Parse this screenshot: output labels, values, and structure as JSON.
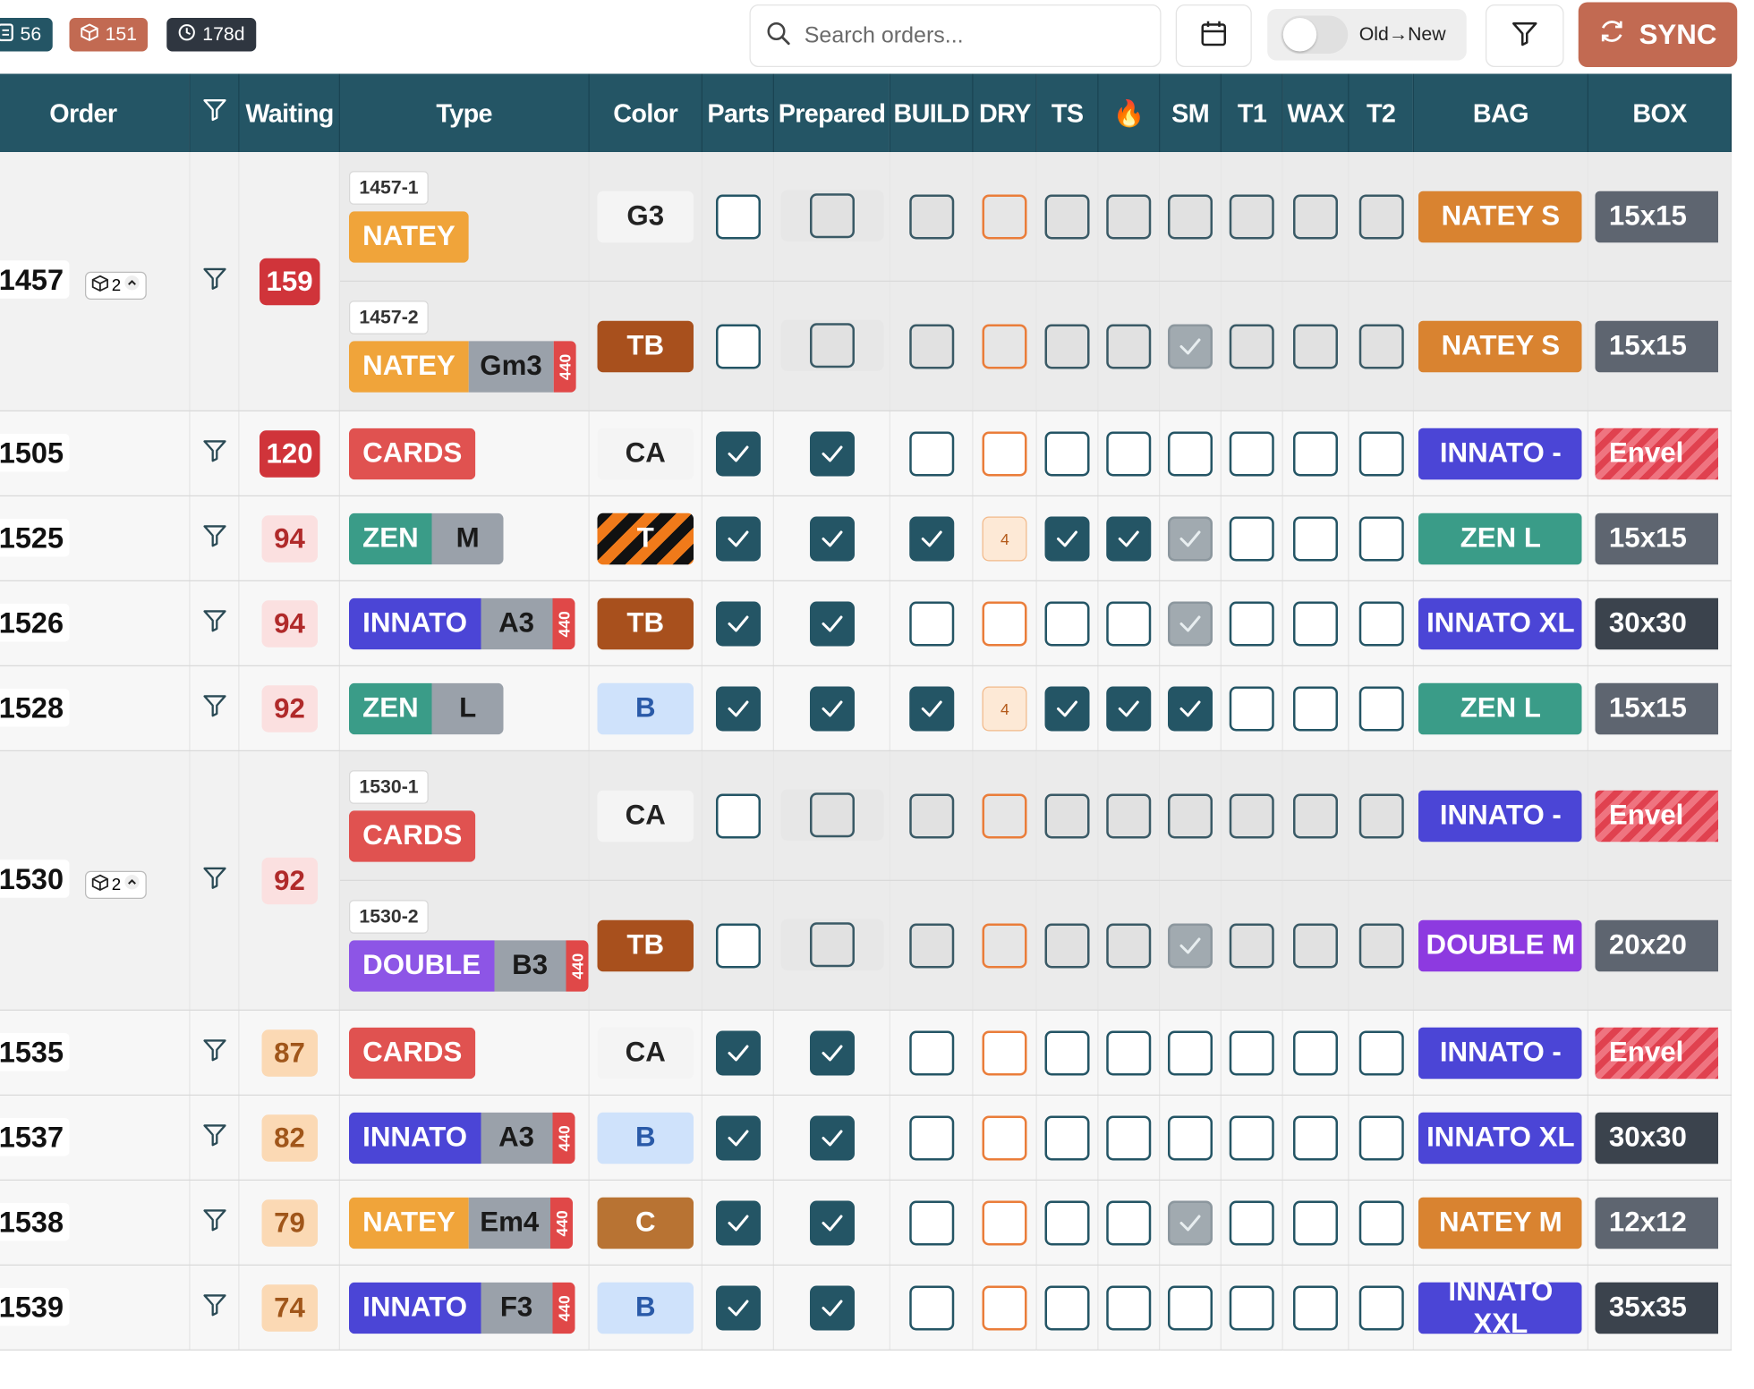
{
  "stats": {
    "orders": "56",
    "parts": "151",
    "age": "178d"
  },
  "search": {
    "placeholder": "Search orders..."
  },
  "sort_toggle": {
    "label": "Old→New"
  },
  "sync": {
    "label": "SYNC"
  },
  "columns": [
    "Order",
    "",
    "Waiting",
    "Type",
    "Color",
    "Parts",
    "Prepared",
    "BUILD",
    "DRY",
    "TS",
    "🔥",
    "SM",
    "T1",
    "WAX",
    "T2",
    "BAG",
    "BOX"
  ],
  "colors": {
    "header": "#245565",
    "natey": "#f0a43a",
    "cards": "#e05250",
    "zen": "#3a9c88",
    "innato": "#4b45d6",
    "double": "#8d55e6",
    "bag_natey": "#d98330",
    "bag_innato": "#4b45d6",
    "bag_zen": "#3a9c88",
    "bag_double": "#8d3ae0",
    "box_dark": "#5e6570",
    "box_darker": "#3b434d"
  },
  "orders": [
    {
      "num": "1457",
      "suborders": "2",
      "waiting": "159",
      "wait_bg": "#d0343a",
      "wait_fg": "#ffffff",
      "subs": [
        {
          "id": "1457-1",
          "type": "NATEY",
          "type_color": "#f0a43a",
          "variant": "",
          "tag": "",
          "color": "G3",
          "color_bg": "#f4f4f4",
          "color_fg": "#222222",
          "checks": [
            "empty",
            "dim",
            "dim",
            "odim",
            "dim",
            "dim",
            "dim",
            "dim",
            "dim",
            "dim"
          ],
          "bag": "NATEY S",
          "bag_bg": "#d98330",
          "box": "15x15",
          "box_type": "dark"
        },
        {
          "id": "1457-2",
          "type": "NATEY",
          "type_color": "#f0a43a",
          "variant": "Gm3",
          "tag": "440",
          "color": "TB",
          "color_bg": "#a8501d",
          "color_fg": "#ffffff",
          "checks": [
            "empty",
            "dim",
            "dim",
            "odim",
            "dim",
            "dim",
            "grey",
            "dim",
            "dim",
            "dim"
          ],
          "bag": "NATEY S",
          "bag_bg": "#d98330",
          "box": "15x15",
          "box_type": "dark"
        }
      ]
    },
    {
      "num": "1505",
      "waiting": "120",
      "wait_bg": "#d0343a",
      "wait_fg": "#ffffff",
      "type": "CARDS",
      "type_color": "#e05250",
      "variant": "",
      "tag": "",
      "color": "CA",
      "color_bg": "#f4f4f4",
      "color_fg": "#222222",
      "checks": [
        "checked",
        "checked",
        "empty",
        "orange",
        "empty",
        "empty",
        "empty",
        "empty",
        "empty",
        "empty"
      ],
      "bag": "INNATO -",
      "bag_bg": "#4b45d6",
      "box": "Envel",
      "box_type": "env"
    },
    {
      "num": "1525",
      "waiting": "94",
      "wait_bg": "#fbe0e0",
      "wait_fg": "#b02a2a",
      "type": "ZEN",
      "type_color": "#3a9c88",
      "variant": "M",
      "tag": "",
      "color": "T",
      "color_bg": "hazard",
      "color_fg": "#ffffff",
      "checks": [
        "checked",
        "checked",
        "checked",
        "num",
        "checked",
        "checked",
        "grey",
        "empty",
        "empty",
        "empty"
      ],
      "dry_num": "4",
      "bag": "ZEN L",
      "bag_bg": "#3a9c88",
      "box": "15x15",
      "box_type": "dark"
    },
    {
      "num": "1526",
      "waiting": "94",
      "wait_bg": "#fbe0e0",
      "wait_fg": "#b02a2a",
      "type": "INNATO",
      "type_color": "#4b45d6",
      "variant": "A3",
      "tag": "440",
      "color": "TB",
      "color_bg": "#a8501d",
      "color_fg": "#ffffff",
      "checks": [
        "checked",
        "checked",
        "empty",
        "orange",
        "empty",
        "empty",
        "grey",
        "empty",
        "empty",
        "empty"
      ],
      "bag": "INNATO XL",
      "bag_bg": "#4b45d6",
      "box": "30x30",
      "box_type": "darker"
    },
    {
      "num": "1528",
      "waiting": "92",
      "wait_bg": "#fbe0e0",
      "wait_fg": "#b02a2a",
      "type": "ZEN",
      "type_color": "#3a9c88",
      "variant": "L",
      "tag": "",
      "color": "B",
      "color_bg": "#cfe2fb",
      "color_fg": "#2a5aa8",
      "checks": [
        "checked",
        "checked",
        "checked",
        "num",
        "checked",
        "checked",
        "checked",
        "empty",
        "empty",
        "empty"
      ],
      "dry_num": "4",
      "bag": "ZEN L",
      "bag_bg": "#3a9c88",
      "box": "15x15",
      "box_type": "dark"
    },
    {
      "num": "1530",
      "suborders": "2",
      "waiting": "92",
      "wait_bg": "#fbe0e0",
      "wait_fg": "#b02a2a",
      "subs": [
        {
          "id": "1530-1",
          "type": "CARDS",
          "type_color": "#e05250",
          "variant": "",
          "tag": "",
          "color": "CA",
          "color_bg": "#f4f4f4",
          "color_fg": "#222222",
          "checks": [
            "empty",
            "dim",
            "dim",
            "odim",
            "dim",
            "dim",
            "dim",
            "dim",
            "dim",
            "dim"
          ],
          "bag": "INNATO -",
          "bag_bg": "#4b45d6",
          "box": "Envel",
          "box_type": "env"
        },
        {
          "id": "1530-2",
          "type": "DOUBLE",
          "type_color": "#8d55e6",
          "variant": "B3",
          "tag": "440",
          "color": "TB",
          "color_bg": "#a8501d",
          "color_fg": "#ffffff",
          "checks": [
            "empty",
            "dim",
            "dim",
            "odim",
            "dim",
            "dim",
            "grey",
            "dim",
            "dim",
            "dim"
          ],
          "bag": "DOUBLE M",
          "bag_bg": "#8d3ae0",
          "box": "20x20",
          "box_type": "dark"
        }
      ]
    },
    {
      "num": "1535",
      "waiting": "87",
      "wait_bg": "#fbd9b4",
      "wait_fg": "#a0561a",
      "type": "CARDS",
      "type_color": "#e05250",
      "variant": "",
      "tag": "",
      "color": "CA",
      "color_bg": "#f4f4f4",
      "color_fg": "#222222",
      "checks": [
        "checked",
        "checked",
        "empty",
        "orange",
        "empty",
        "empty",
        "empty",
        "empty",
        "empty",
        "empty"
      ],
      "bag": "INNATO -",
      "bag_bg": "#4b45d6",
      "box": "Envel",
      "box_type": "env"
    },
    {
      "num": "1537",
      "waiting": "82",
      "wait_bg": "#fbd9b4",
      "wait_fg": "#a0561a",
      "type": "INNATO",
      "type_color": "#4b45d6",
      "variant": "A3",
      "tag": "440",
      "color": "B",
      "color_bg": "#cfe2fb",
      "color_fg": "#2a5aa8",
      "checks": [
        "checked",
        "checked",
        "empty",
        "orange",
        "empty",
        "empty",
        "empty",
        "empty",
        "empty",
        "empty"
      ],
      "bag": "INNATO XL",
      "bag_bg": "#4b45d6",
      "box": "30x30",
      "box_type": "darker"
    },
    {
      "num": "1538",
      "waiting": "79",
      "wait_bg": "#fbd9b4",
      "wait_fg": "#a0561a",
      "type": "NATEY",
      "type_color": "#f0a43a",
      "variant": "Em4",
      "tag": "440",
      "color": "C",
      "color_bg": "#b87333",
      "color_fg": "#ffffff",
      "checks": [
        "checked",
        "checked",
        "empty",
        "orange",
        "empty",
        "empty",
        "grey",
        "empty",
        "empty",
        "empty"
      ],
      "bag": "NATEY M",
      "bag_bg": "#d98330",
      "box": "12x12",
      "box_type": "dark"
    },
    {
      "num": "1539",
      "waiting": "74",
      "wait_bg": "#fbd9b4",
      "wait_fg": "#a0561a",
      "type": "INNATO",
      "type_color": "#4b45d6",
      "variant": "F3",
      "tag": "440",
      "color": "B",
      "color_bg": "#cfe2fb",
      "color_fg": "#2a5aa8",
      "checks": [
        "checked",
        "checked",
        "empty",
        "orange",
        "empty",
        "empty",
        "empty",
        "empty",
        "empty",
        "empty"
      ],
      "bag": "INNATO XXL",
      "bag_bg": "#4b45d6",
      "box": "35x35",
      "box_type": "darker"
    }
  ]
}
